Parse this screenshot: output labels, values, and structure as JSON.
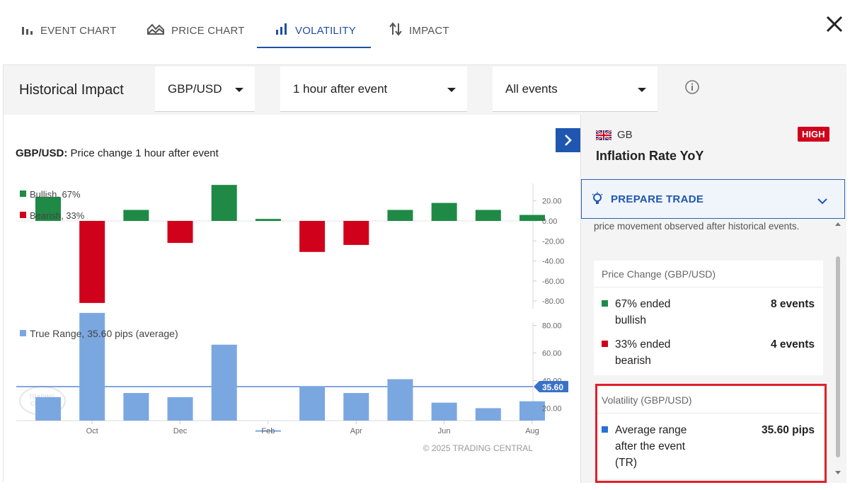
{
  "tabs": [
    {
      "label": "EVENT CHART",
      "icon": "bar-chart-icon",
      "active": false
    },
    {
      "label": "PRICE CHART",
      "icon": "area-chart-icon",
      "active": false
    },
    {
      "label": "VOLATILITY",
      "icon": "volatility-bars-icon",
      "active": true
    },
    {
      "label": "IMPACT",
      "icon": "sort-arrows-icon",
      "active": false
    }
  ],
  "header": {
    "title": "Historical Impact",
    "pair_select": "GBP/USD",
    "time_select": "1 hour after event",
    "events_select": "All events"
  },
  "chart_heading": {
    "pair": "GBP/USD:",
    "text": " Price change 1 hour after event"
  },
  "chart_data": [
    {
      "type": "bar",
      "title": "GBP/USD: Price change 1 hour after event",
      "series": [
        {
          "name": "Bullish, 67%",
          "color": "#1e8a45"
        },
        {
          "name": "Bearish, 33%",
          "color": "#d0021b"
        }
      ],
      "values": [
        24,
        -82,
        11,
        -22,
        36,
        2,
        -31,
        -24,
        11,
        18,
        11,
        6
      ],
      "ylim": [
        -85,
        35
      ],
      "yticks": [
        "20.00",
        "0.00",
        "-20.00",
        "-40.00",
        "-60.00",
        "-80.00"
      ],
      "ytick_values": [
        20,
        0,
        -20,
        -40,
        -60,
        -80
      ]
    },
    {
      "type": "bar",
      "series": [
        {
          "name": "True Range, 35.60 pips (average)",
          "color": "#7ba7e1"
        }
      ],
      "values": [
        28,
        89,
        31,
        28,
        66,
        4,
        36,
        31,
        41,
        24,
        20,
        25
      ],
      "average": 35.6,
      "average_label": "35.60",
      "ylim": [
        10,
        90
      ],
      "yticks": [
        "80.00",
        "60.00",
        "40.00",
        "20.00"
      ],
      "ytick_values": [
        80,
        60,
        40,
        20
      ],
      "xticks": [
        "Oct",
        "Dec",
        "Feb",
        "Apr",
        "Jun",
        "Aug"
      ]
    }
  ],
  "copyright": "© 2025 TRADING CENTRAL",
  "sidebar": {
    "country": "GB",
    "importance": "HIGH",
    "event_name": "Inflation Rate YoY",
    "prepare_label": "PREPARE TRADE",
    "description": "price movement observed after historical events.",
    "price_change": {
      "title": "Price Change (GBP/USD)",
      "rows": [
        {
          "label": "67% ended bullish",
          "value": "8 events",
          "color": "#1e8a45"
        },
        {
          "label": "33% ended bearish",
          "value": "4 events",
          "color": "#d0021b"
        }
      ]
    },
    "volatility": {
      "title": "Volatility (GBP/USD)",
      "rows": [
        {
          "label": "Average range after the event (TR)",
          "value": "35.60 pips",
          "color": "#2a6fd6"
        }
      ]
    }
  }
}
